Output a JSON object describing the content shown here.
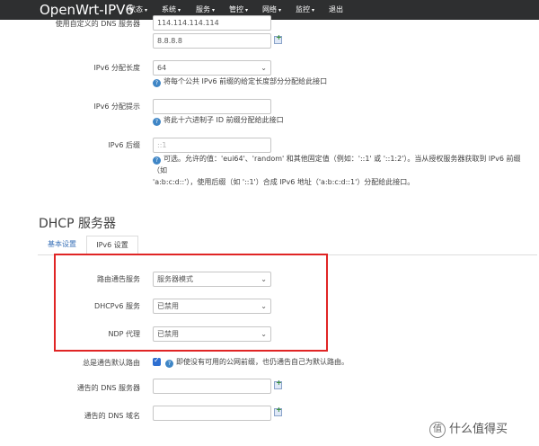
{
  "navbar": {
    "brand": "OpenWrt-IPV6",
    "menu": [
      "状态",
      "系统",
      "服务",
      "管控",
      "网络",
      "监控",
      "退出"
    ]
  },
  "form_top": {
    "custom_dns_label": "使用自定义的 DNS 服务器",
    "dns1_value": "114.114.114.114",
    "dns2_value": "8.8.8.8",
    "ipv6_assign_len_label": "IPv6 分配长度",
    "ipv6_assign_len_value": "64",
    "ipv6_assign_len_help": "将每个公共 IPv6 前缀的给定长度部分分配给此接口",
    "ipv6_hint_label": "IPv6 分配提示",
    "ipv6_hint_help": "将此十六进制子 ID 前缀分配给此接口",
    "ipv6_suffix_label": "IPv6 后缀",
    "ipv6_suffix_placeholder": "::1",
    "ipv6_suffix_help_1": "可选。允许的值：'eui64'、'random' 和其他固定值（例如：'::1' 或 '::1:2'）。当从授权服务器获取到 IPv6 前缀（如",
    "ipv6_suffix_help_2": "'a:b:c:d::'），使用后缀（如 '::1'）合成 IPv6 地址（'a:b:c:d::1'）分配给此接口。"
  },
  "dhcp": {
    "title": "DHCP 服务器",
    "tab_basic": "基本设置",
    "tab_ipv6": "IPv6 设置",
    "ra_label": "路由通告服务",
    "ra_value": "服务器模式",
    "dhcpv6_label": "DHCPv6 服务",
    "dhcpv6_value": "已禁用",
    "ndp_label": "NDP 代理",
    "ndp_value": "已禁用",
    "default_router_label": "总是通告默认路由",
    "default_router_help": "即使没有可用的公网前缀，也仍通告自己为默认路由。",
    "announced_dns_label": "通告的 DNS 服务器",
    "announced_domain_label": "通告的 DNS 域名"
  },
  "watermark": {
    "text": "什么值得买",
    "icon_char": "值"
  }
}
